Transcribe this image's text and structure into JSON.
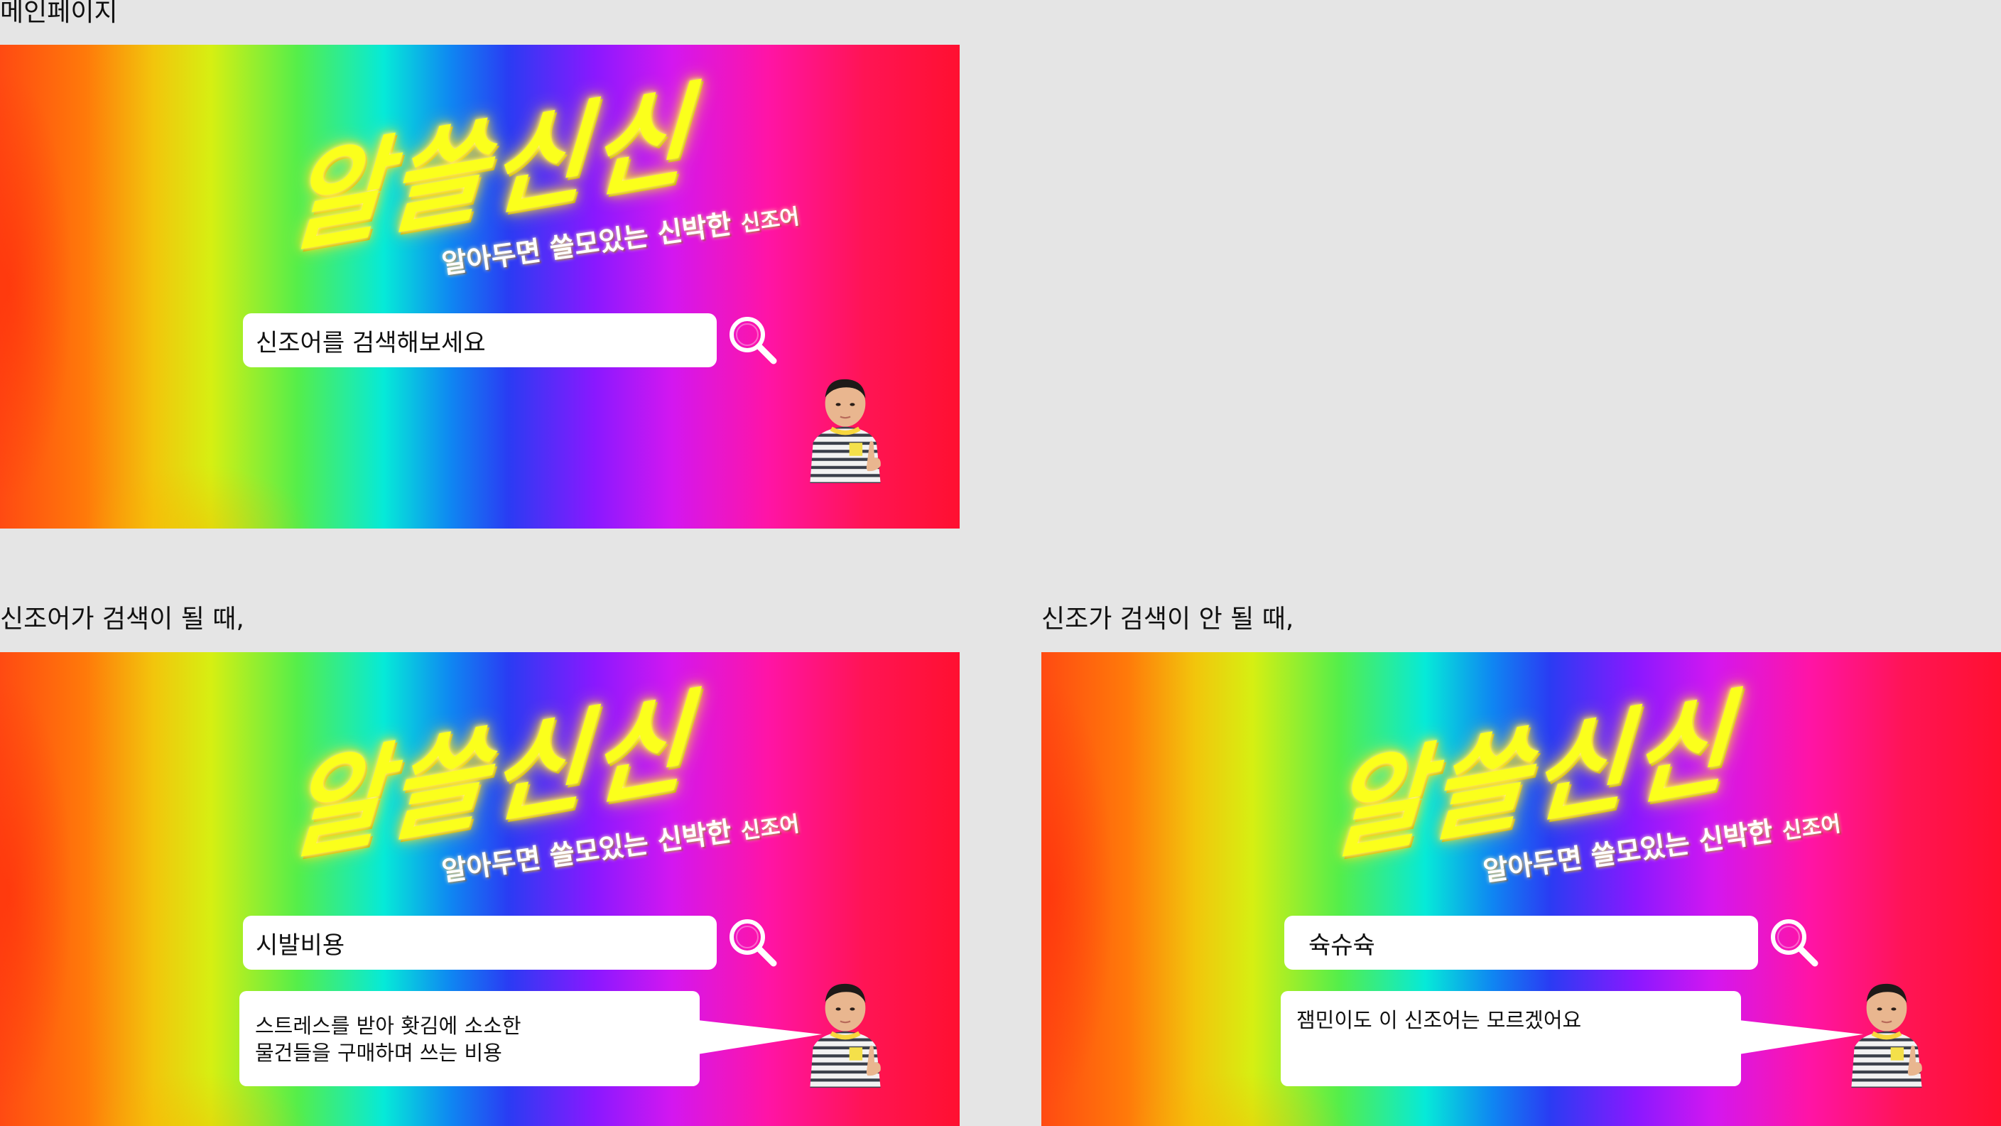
{
  "labels": {
    "main": "메인페이지",
    "found": "신조어가 검색이 될 때,",
    "not_found": "신조가 검색이 안 될 때,"
  },
  "banner": {
    "logo": "알쓸신신",
    "tagline_main": "알아두면 쓸모있는 신박한 ",
    "tagline_tail": "신조어"
  },
  "main_page": {
    "search_placeholder": "신조어를 검색해보세요"
  },
  "found_page": {
    "search_value": "시발비용",
    "result_line1": "스트레스를 받아 홧김에 소소한",
    "result_line2": "물건들을 구매하며 쓰는 비용"
  },
  "not_found_page": {
    "search_value": "슉슈슉",
    "result_line1": "잼민이도 이 신조어는 모르겠어요",
    "result_line2": ""
  },
  "icons": {
    "search": "magnifier-icon",
    "character": "kid-thumbs-up"
  },
  "colors": {
    "page_bg": "#e5e5e5",
    "logo_yellow": "#fbff1c",
    "box_white": "#ffffff"
  }
}
